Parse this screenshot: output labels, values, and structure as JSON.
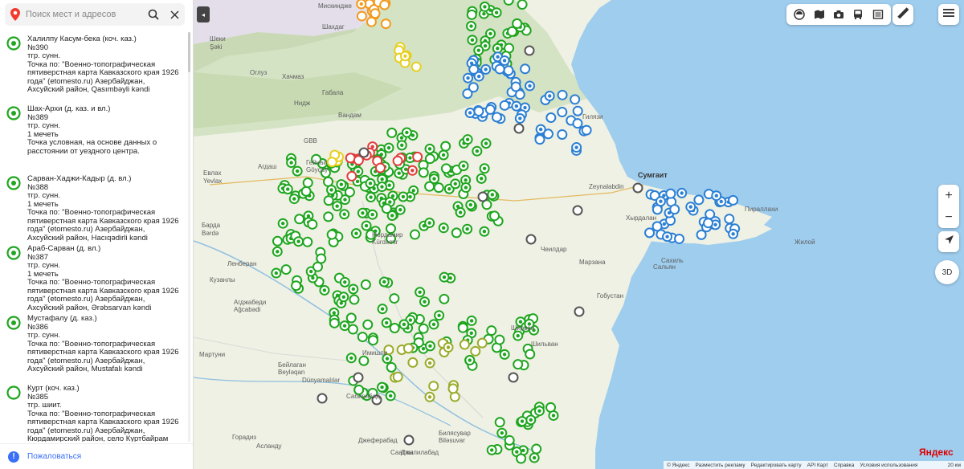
{
  "search": {
    "placeholder": "Поиск мест и адресов"
  },
  "places": [
    {
      "title": "Халилпу Касум-бека (коч. каз.)",
      "number": "№390",
      "lines": [
        "тгр. сунн.",
        "Точка по: \"Военно-топографическая пятиверстная карта Кавказского края 1926 года\" (etomesto.ru) Азербайджан, Ахсуйский район, Qasımbəyli kəndi"
      ],
      "status": "green"
    },
    {
      "title": "Шах-Архи (д. каз. и вл.)",
      "number": "№389",
      "lines": [
        "тгр. сунн.",
        "1 мечеть",
        "Точка условная, на основе данных о расстоянии от уездного центра."
      ],
      "status": "green"
    },
    {
      "title": "Сарван-Хаджи-Кадыр (д. вл.)",
      "number": "№388",
      "lines": [
        "тгр. сунн.",
        "1 мечеть",
        "Точка по: \"Военно-топографическая пятиверстная карта Кавказского края 1926 года\" (etomesto.ru) Азербайджан, Ахсуйский район, Hacıqədirli kəndi"
      ],
      "status": "green"
    },
    {
      "title": "Араб-Сарван (д. вл.)",
      "number": "№387",
      "lines": [
        "тгр. сунн.",
        "1 мечеть",
        "Точка по: \"Военно-топографическая пятиверстная карта Кавказского края 1926 года\" (etomesto.ru) Азербайджан, Ахсуйский район, Ərəbsarvan kəndi"
      ],
      "status": "green"
    },
    {
      "title": "Мустафалу (д. каз.)",
      "number": "№386",
      "lines": [
        "тгр. сунн.",
        "Точка по: \"Военно-топографическая пятиверстная карта Кавказского края 1926 года\" (etomesto.ru) Азербайджан, Ахсуйский район, Mustafalı kəndi"
      ],
      "status": "green"
    },
    {
      "title": "Курт (коч. каз.)",
      "number": "№385",
      "lines": [
        "тгр. шиит.",
        "Точка по: \"Военно-топографическая пятиверстная карта Кавказского края 1926 года\" (etomesto.ru) Азербайджан, Кюрдамирский район, село Куртбайрам"
      ],
      "status": "green-hollow"
    }
  ],
  "complain": {
    "label": "Пожаловаться",
    "icon": "exclamation-icon"
  },
  "toolbar": {
    "icons": [
      "layers-icon",
      "map-book-icon",
      "camera-icon",
      "bus-icon",
      "panorama-icon"
    ],
    "ruler": "ruler-icon",
    "menu": "menu-icon"
  },
  "controls": {
    "zoom_in": "+",
    "zoom_out": "−",
    "btn3d": "3D"
  },
  "brand": "Яндекс",
  "footer": {
    "links": [
      "© Яндекс",
      "Разместить рекламу",
      "Редактировать карту",
      "API Карт",
      "Справка",
      "Условия использования"
    ],
    "scale": "20 км"
  },
  "colors": {
    "green": "#1fa51f",
    "blue": "#2b7fd4",
    "red": "#e23c3c",
    "orange": "#f29a1b",
    "yellow": "#e7cf1f",
    "olive": "#9aab2a",
    "gray": "#555555",
    "sea": "#9fcdee",
    "accent": "#3a6ff7"
  },
  "map_labels": [
    {
      "text": "Мискиндже",
      "cls": ""
    },
    {
      "text": "Шахдаг",
      "cls": ""
    },
    {
      "text": "Шеки",
      "cls": ""
    },
    {
      "text": "Şəki",
      "cls": ""
    },
    {
      "text": "Оглуз",
      "cls": ""
    },
    {
      "text": "Хачмаз",
      "cls": ""
    },
    {
      "text": "Нидж",
      "cls": ""
    },
    {
      "text": "Габала",
      "cls": ""
    },
    {
      "text": "Вандам",
      "cls": ""
    },
    {
      "text": "Евлах",
      "cls": ""
    },
    {
      "text": "Yevlax",
      "cls": ""
    },
    {
      "text": "Агдаш",
      "cls": ""
    },
    {
      "text": "Гейчай",
      "cls": ""
    },
    {
      "text": "Göyçay",
      "cls": ""
    },
    {
      "text": "Барда",
      "cls": ""
    },
    {
      "text": "Bərdə",
      "cls": ""
    },
    {
      "text": "Кюрдамир",
      "cls": ""
    },
    {
      "text": "Kürdəmir",
      "cls": ""
    },
    {
      "text": "Ленберан",
      "cls": ""
    },
    {
      "text": "Кузанлы",
      "cls": ""
    },
    {
      "text": "Агджабеди",
      "cls": ""
    },
    {
      "text": "Ağcabədi",
      "cls": ""
    },
    {
      "text": "Бейлаган",
      "cls": ""
    },
    {
      "text": "Beyləqan",
      "cls": ""
    },
    {
      "text": "Имишли",
      "cls": ""
    },
    {
      "text": "Сабирабад",
      "cls": ""
    },
    {
      "text": "Саатлы",
      "cls": ""
    },
    {
      "text": "Ширван",
      "cls": ""
    },
    {
      "text": "Сальян",
      "cls": ""
    },
    {
      "text": "Сумгаит",
      "cls": "city"
    },
    {
      "text": "Хырдалан",
      "cls": ""
    },
    {
      "text": "Пираллахи",
      "cls": ""
    },
    {
      "text": "Жилой",
      "cls": ""
    },
    {
      "text": "Сахиль",
      "cls": ""
    },
    {
      "text": "Гобустан",
      "cls": ""
    },
    {
      "text": "Zeynalabdin",
      "cls": ""
    },
    {
      "text": "Гилязи",
      "cls": ""
    },
    {
      "text": "Джалилабад",
      "cls": ""
    },
    {
      "text": "Горадиз",
      "cls": ""
    },
    {
      "text": "Асланду",
      "cls": ""
    },
    {
      "text": "Джеферабад",
      "cls": ""
    },
    {
      "text": "Билясувар",
      "cls": ""
    },
    {
      "text": "Biləsuvar",
      "cls": ""
    },
    {
      "text": "Dünyamalılar",
      "cls": ""
    },
    {
      "text": "Чеилдар",
      "cls": ""
    },
    {
      "text": "Марзана",
      "cls": ""
    },
    {
      "text": "Шильван",
      "cls": ""
    },
    {
      "text": "Мартуни",
      "cls": ""
    },
    {
      "text": "GBB",
      "cls": ""
    }
  ]
}
